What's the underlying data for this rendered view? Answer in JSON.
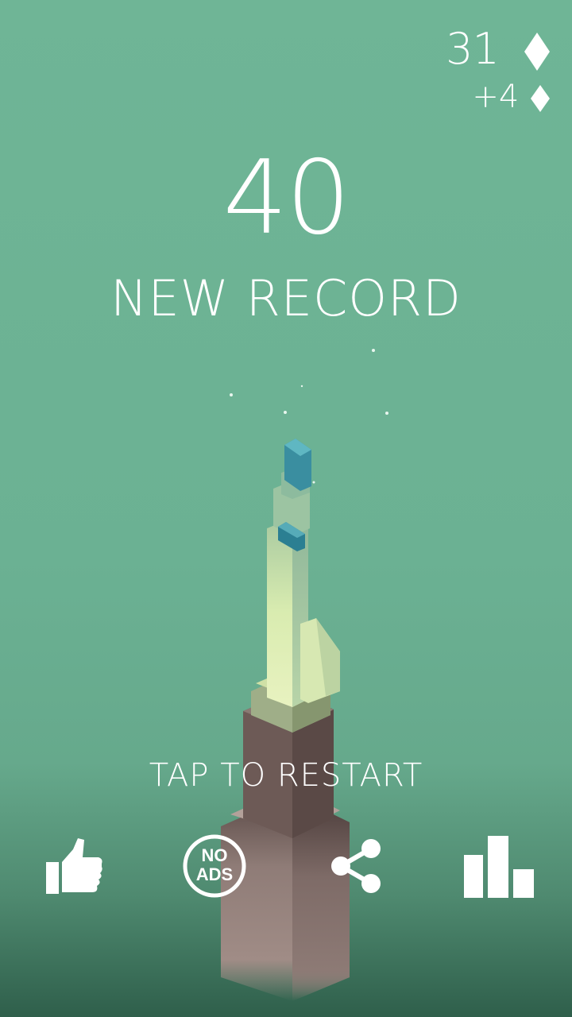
{
  "hud": {
    "gems_total": "31",
    "gems_gained": "+4",
    "gem_icon": "diamond-icon"
  },
  "result": {
    "score": "40",
    "status": "NEW RECORD"
  },
  "prompt": {
    "restart": "TAP TO RESTART"
  },
  "buttons": {
    "like_icon": "thumbs-up-icon",
    "no_ads_line1": "NO",
    "no_ads_line2": "ADS",
    "share_icon": "share-icon",
    "leaderboard_icon": "leaderboard-icon"
  },
  "colors": {
    "background": "#6fb596",
    "tower_base": "#8e7a76",
    "tower_top": "#d8e6b0",
    "tower_cap": "#2e8c9c",
    "text": "#ffffff"
  }
}
